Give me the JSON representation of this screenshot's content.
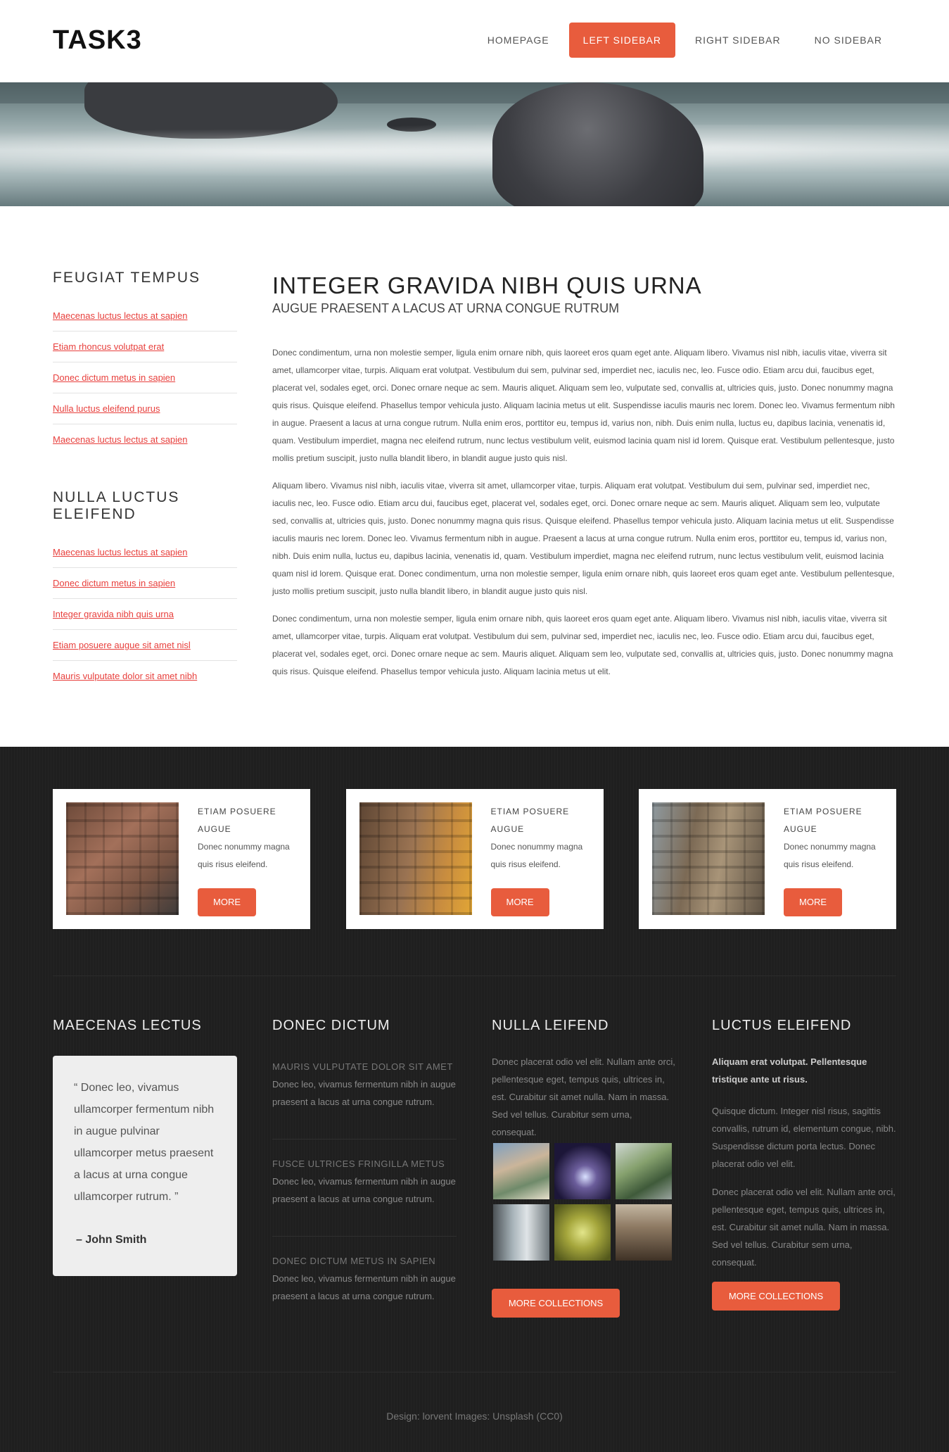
{
  "header": {
    "logo": "TASK3",
    "nav": [
      {
        "label": "HOMEPAGE"
      },
      {
        "label": "LEFT SIDEBAR",
        "active": true
      },
      {
        "label": "RIGHT SIDEBAR"
      },
      {
        "label": "NO SIDEBAR"
      }
    ]
  },
  "sidebar": {
    "sections": [
      {
        "title": "FEUGIAT TEMPUS",
        "links": [
          "Maecenas luctus lectus at sapien",
          "Etiam rhoncus volutpat erat",
          "Donec dictum metus in sapien",
          "Nulla luctus eleifend purus",
          "Maecenas luctus lectus at sapien"
        ]
      },
      {
        "title": "NULLA LUCTUS ELEIFEND",
        "links": [
          "Maecenas luctus lectus at sapien",
          "Donec dictum metus in sapien",
          "Integer gravida nibh quis urna",
          "Etiam posuere augue sit amet nisl",
          "Mauris vulputate dolor sit amet nibh"
        ]
      }
    ]
  },
  "content": {
    "title": "INTEGER GRAVIDA NIBH QUIS URNA",
    "subtitle": "AUGUE PRAESENT A LACUS AT URNA CONGUE RUTRUM",
    "paragraphs": [
      "Donec condimentum, urna non molestie semper, ligula enim ornare nibh, quis laoreet eros quam eget ante. Aliquam libero. Vivamus nisl nibh, iaculis vitae, viverra sit amet, ullamcorper vitae, turpis. Aliquam erat volutpat. Vestibulum dui sem, pulvinar sed, imperdiet nec, iaculis nec, leo. Fusce odio. Etiam arcu dui, faucibus eget, placerat vel, sodales eget, orci. Donec ornare neque ac sem. Mauris aliquet. Aliquam sem leo, vulputate sed, convallis at, ultricies quis, justo. Donec nonummy magna quis risus. Quisque eleifend. Phasellus tempor vehicula justo. Aliquam lacinia metus ut elit. Suspendisse iaculis mauris nec lorem. Donec leo. Vivamus fermentum nibh in augue. Praesent a lacus at urna congue rutrum. Nulla enim eros, porttitor eu, tempus id, varius non, nibh. Duis enim nulla, luctus eu, dapibus lacinia, venenatis id, quam. Vestibulum imperdiet, magna nec eleifend rutrum, nunc lectus vestibulum velit, euismod lacinia quam nisl id lorem. Quisque erat. Vestibulum pellentesque, justo mollis pretium suscipit, justo nulla blandit libero, in blandit augue justo quis nisl.",
      "Aliquam libero. Vivamus nisl nibh, iaculis vitae, viverra sit amet, ullamcorper vitae, turpis. Aliquam erat volutpat. Vestibulum dui sem, pulvinar sed, imperdiet nec, iaculis nec, leo. Fusce odio. Etiam arcu dui, faucibus eget, placerat vel, sodales eget, orci. Donec ornare neque ac sem. Mauris aliquet. Aliquam sem leo, vulputate sed, convallis at, ultricies quis, justo. Donec nonummy magna quis risus. Quisque eleifend. Phasellus tempor vehicula justo. Aliquam lacinia metus ut elit. Suspendisse iaculis mauris nec lorem. Donec leo. Vivamus fermentum nibh in augue. Praesent a lacus at urna congue rutrum. Nulla enim eros, porttitor eu, tempus id, varius non, nibh. Duis enim nulla, luctus eu, dapibus lacinia, venenatis id, quam. Vestibulum imperdiet, magna nec eleifend rutrum, nunc lectus vestibulum velit, euismod lacinia quam nisl id lorem. Quisque erat. Donec condimentum, urna non molestie semper, ligula enim ornare nibh, quis laoreet eros quam eget ante. Vestibulum pellentesque, justo mollis pretium suscipit, justo nulla blandit libero, in blandit augue justo quis nisl.",
      "Donec condimentum, urna non molestie semper, ligula enim ornare nibh, quis laoreet eros quam eget ante. Aliquam libero. Vivamus nisl nibh, iaculis vitae, viverra sit amet, ullamcorper vitae, turpis. Aliquam erat volutpat. Vestibulum dui sem, pulvinar sed, imperdiet nec, iaculis nec, leo. Fusce odio. Etiam arcu dui, faucibus eget, placerat vel, sodales eget, orci. Donec ornare neque ac sem. Mauris aliquet. Aliquam sem leo, vulputate sed, convallis at, ultricies quis, justo. Donec nonummy magna quis risus. Quisque eleifend. Phasellus tempor vehicula justo. Aliquam lacinia metus ut elit."
    ]
  },
  "cards": [
    {
      "title": "ETIAM POSUERE AUGUE",
      "text": "Donec nonummy magna quis risus eleifend.",
      "button": "MORE"
    },
    {
      "title": "ETIAM POSUERE AUGUE",
      "text": "Donec nonummy magna quis risus eleifend.",
      "button": "MORE"
    },
    {
      "title": "ETIAM POSUERE AUGUE",
      "text": "Donec nonummy magna quis risus eleifend.",
      "button": "MORE"
    }
  ],
  "footer_cols": {
    "col1": {
      "title": "MAECENAS LECTUS",
      "quote": "“ Donec leo, vivamus ullamcorper fermentum nibh in augue pulvinar ullamcorper metus praesent a lacus at urna congue ullamcorper rutrum. ”",
      "author": "– John Smith"
    },
    "col2": {
      "title": "DONEC DICTUM",
      "entries": [
        {
          "title": "MAURIS VULPUTATE DOLOR SIT AMET",
          "text": "Donec leo, vivamus fermentum nibh in augue praesent a lacus at urna congue rutrum."
        },
        {
          "title": "FUSCE ULTRICES FRINGILLA METUS",
          "text": "Donec leo, vivamus fermentum nibh in augue praesent a lacus at urna congue rutrum."
        },
        {
          "title": "DONEC DICTUM METUS IN SAPIEN",
          "text": "Donec leo, vivamus fermentum nibh in augue praesent a lacus at urna congue rutrum."
        }
      ]
    },
    "col3": {
      "title": "NULLA LEIFEND",
      "text": "Donec placerat odio vel elit. Nullam ante orci, pellentesque eget, tempus quis, ultrices in, est. Curabitur sit amet nulla. Nam in massa. Sed vel tellus. Curabitur sem urna, consequat.",
      "button": "MORE COLLECTIONS"
    },
    "col4": {
      "title": "LUCTUS ELEIFEND",
      "bold": "Aliquam erat volutpat. Pellentesque tristique ante ut risus.",
      "text1": "Quisque dictum. Integer nisl risus, sagittis convallis, rutrum id, elementum congue, nibh. Suspendisse dictum porta lectus. Donec placerat odio vel elit.",
      "text2": "Donec placerat odio vel elit. Nullam ante orci, pellentesque eget, tempus quis, ultrices in, est. Curabitur sit amet nulla. Nam in massa. Sed vel tellus. Curabitur sem urna, consequat.",
      "button": "MORE COLLECTIONS"
    }
  },
  "footer": {
    "credits": "Design: lorvent Images: Unsplash (CC0)"
  },
  "colors": {
    "accent": "#e85c3d",
    "link": "#e8403d",
    "dark_bg": "#1f1f1f"
  }
}
